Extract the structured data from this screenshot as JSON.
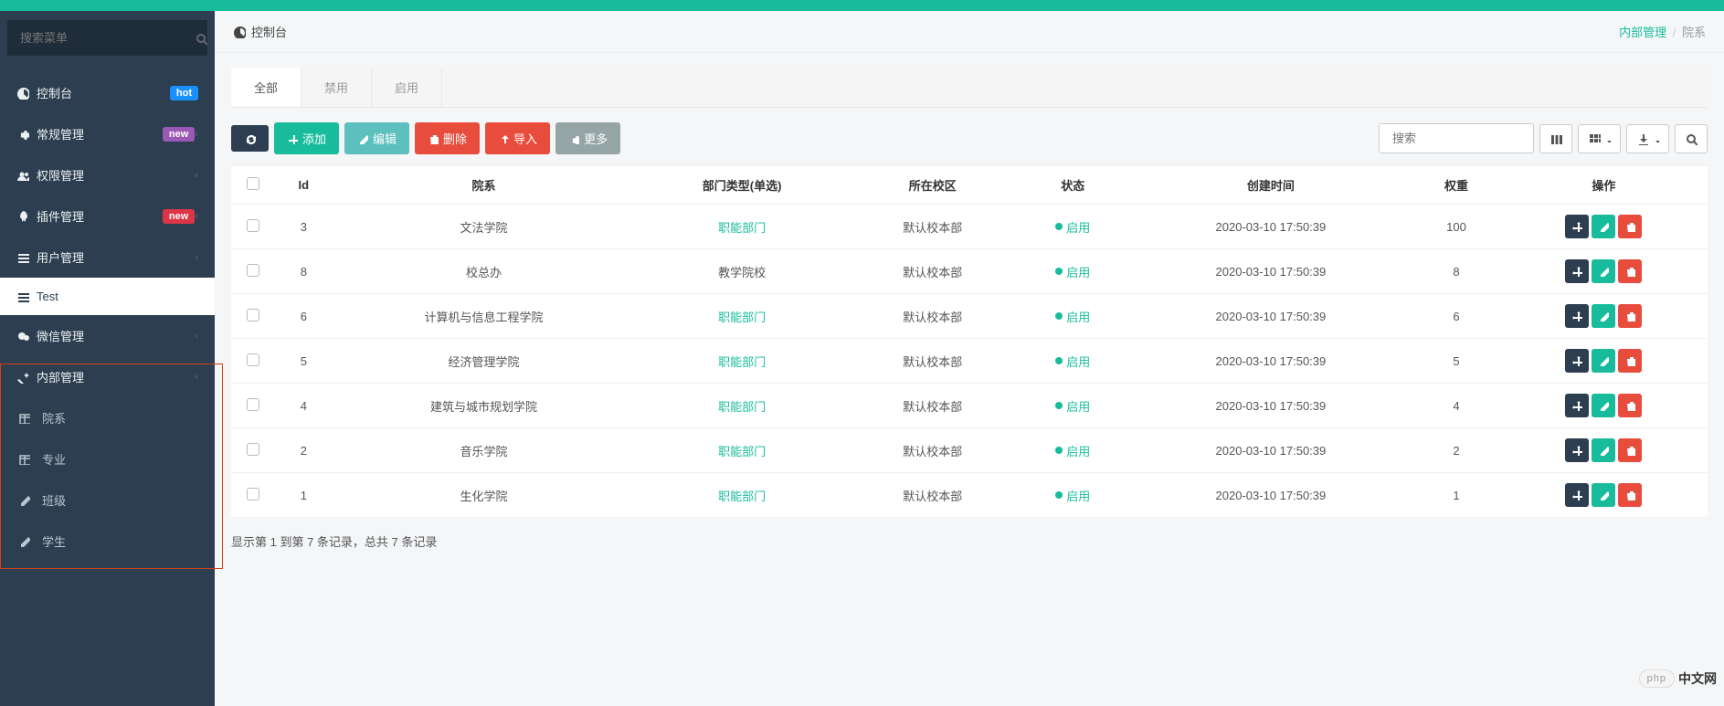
{
  "sidebar": {
    "search_placeholder": "搜索菜单",
    "items": [
      {
        "icon": "dashboard",
        "label": "控制台",
        "badge": "hot",
        "badge_class": "badge-hot"
      },
      {
        "icon": "gear",
        "label": "常规管理",
        "badge": "new",
        "badge_class": "badge-new",
        "chevron": true
      },
      {
        "icon": "users",
        "label": "权限管理",
        "chevron": true
      },
      {
        "icon": "rocket",
        "label": "插件管理",
        "badge": "new",
        "badge_class": "badge-new2",
        "chevron": true
      },
      {
        "icon": "list",
        "label": "用户管理",
        "chevron": true
      },
      {
        "icon": "list",
        "label": "Test",
        "active": true
      },
      {
        "icon": "wechat",
        "label": "微信管理",
        "chevron": true
      },
      {
        "icon": "magic",
        "label": "内部管理",
        "chevron": true
      }
    ],
    "sub_items": [
      {
        "icon": "table",
        "label": "院系"
      },
      {
        "icon": "table",
        "label": "专业"
      },
      {
        "icon": "edit",
        "label": "班级"
      },
      {
        "icon": "edit",
        "label": "学生"
      }
    ]
  },
  "breadcrumb": {
    "title": "控制台",
    "path": [
      "内部管理",
      "院系"
    ]
  },
  "tabs": [
    {
      "label": "全部",
      "active": true
    },
    {
      "label": "禁用"
    },
    {
      "label": "启用"
    }
  ],
  "toolbar": {
    "refresh_title": "刷新",
    "add": "添加",
    "edit": "编辑",
    "delete": "删除",
    "import": "导入",
    "more": "更多",
    "search_placeholder": "搜索"
  },
  "table": {
    "headers": [
      "",
      "Id",
      "院系",
      "部门类型(单选)",
      "所在校区",
      "状态",
      "创建时间",
      "权重",
      "操作"
    ],
    "rows": [
      {
        "id": "3",
        "name": "文法学院",
        "type": "职能部门",
        "type_green": true,
        "campus": "默认校本部",
        "status": "启用",
        "created": "2020-03-10 17:50:39",
        "weight": "100"
      },
      {
        "id": "8",
        "name": "校总办",
        "type": "教学院校",
        "type_green": false,
        "campus": "默认校本部",
        "status": "启用",
        "created": "2020-03-10 17:50:39",
        "weight": "8"
      },
      {
        "id": "6",
        "name": "计算机与信息工程学院",
        "type": "职能部门",
        "type_green": true,
        "campus": "默认校本部",
        "status": "启用",
        "created": "2020-03-10 17:50:39",
        "weight": "6"
      },
      {
        "id": "5",
        "name": "经济管理学院",
        "type": "职能部门",
        "type_green": true,
        "campus": "默认校本部",
        "status": "启用",
        "created": "2020-03-10 17:50:39",
        "weight": "5"
      },
      {
        "id": "4",
        "name": "建筑与城市规划学院",
        "type": "职能部门",
        "type_green": true,
        "campus": "默认校本部",
        "status": "启用",
        "created": "2020-03-10 17:50:39",
        "weight": "4"
      },
      {
        "id": "2",
        "name": "音乐学院",
        "type": "职能部门",
        "type_green": true,
        "campus": "默认校本部",
        "status": "启用",
        "created": "2020-03-10 17:50:39",
        "weight": "2"
      },
      {
        "id": "1",
        "name": "生化学院",
        "type": "职能部门",
        "type_green": true,
        "campus": "默认校本部",
        "status": "启用",
        "created": "2020-03-10 17:50:39",
        "weight": "1"
      }
    ],
    "footer": "显示第 1 到第 7 条记录，总共 7 条记录"
  },
  "watermark": {
    "badge": "php",
    "text": "中文网"
  }
}
